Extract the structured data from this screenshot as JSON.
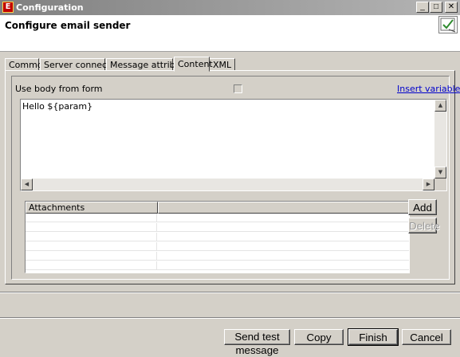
{
  "window": {
    "title": "Configuration",
    "app_icon_letter": "E",
    "minimize_glyph": "_",
    "maximize_glyph": "□",
    "close_glyph": "✕"
  },
  "header": {
    "title": "Configure email sender",
    "icon": "checkmark-document-icon"
  },
  "tabs": [
    {
      "label": "Common",
      "active": false
    },
    {
      "label": "Server connection",
      "active": false
    },
    {
      "label": "Message attributes",
      "active": false
    },
    {
      "label": "Content",
      "active": true
    },
    {
      "label": "XML",
      "active": false
    }
  ],
  "content": {
    "use_body_label": "Use body from form",
    "use_body_checked": false,
    "insert_variable_link": "Insert variable",
    "body_text": "Hello ${param}"
  },
  "attachments": {
    "columns": [
      "Attachments",
      ""
    ],
    "rows": [],
    "add_label": "Add",
    "delete_label": "Delete",
    "delete_enabled": false
  },
  "footer": {
    "send_test_label": "Send test message",
    "copy_label": "Copy",
    "finish_label": "Finish",
    "cancel_label": "Cancel"
  },
  "colors": {
    "dialog_bg": "#d4d0c8",
    "link": "#0000cc",
    "titlebar_inactive": "#808080"
  }
}
